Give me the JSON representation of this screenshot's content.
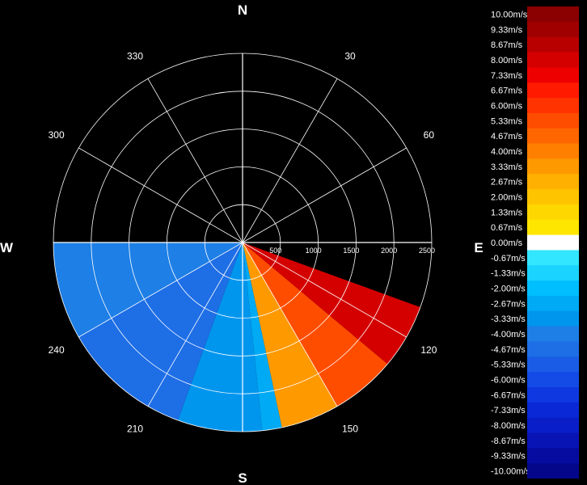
{
  "chart_data": {
    "type": "heatmap",
    "subtype": "polar radial-velocity sector scan",
    "compass": {
      "north": "N",
      "south": "S",
      "east": "E",
      "west": "W"
    },
    "azimuth_labels": [
      "30",
      "60",
      "120",
      "150",
      "210",
      "240",
      "300",
      "330"
    ],
    "range_labels": [
      "500",
      "1000",
      "1500",
      "2000",
      "2500"
    ],
    "range_max": 2500,
    "grid": true,
    "scan_sector": {
      "from_azimuth": 110,
      "to_azimuth": 270
    },
    "velocity_field": [
      {
        "azimuth_from": 110,
        "azimuth_to": 130,
        "velocity_mps": 8.0
      },
      {
        "azimuth_from": 130,
        "azimuth_to": 150,
        "velocity_mps": 5.0
      },
      {
        "azimuth_from": 150,
        "azimuth_to": 168,
        "velocity_mps": 3.33
      },
      {
        "azimuth_from": 168,
        "azimuth_to": 174,
        "velocity_mps": -2.67
      },
      {
        "azimuth_from": 174,
        "azimuth_to": 200,
        "velocity_mps": -3.33
      },
      {
        "azimuth_from": 200,
        "azimuth_to": 240,
        "velocity_mps": -4.67
      },
      {
        "azimuth_from": 240,
        "azimuth_to": 270,
        "velocity_mps": -4.0
      }
    ],
    "legend": {
      "position": "right",
      "entries": [
        {
          "label": "10.00m/s",
          "color": "#8b0000",
          "value": 10.0
        },
        {
          "label": "9.33m/s",
          "color": "#a00000",
          "value": 9.33
        },
        {
          "label": "8.67m/s",
          "color": "#b80000",
          "value": 8.67
        },
        {
          "label": "8.00m/s",
          "color": "#d40000",
          "value": 8.0
        },
        {
          "label": "7.33m/s",
          "color": "#ee0000",
          "value": 7.33
        },
        {
          "label": "6.67m/s",
          "color": "#ff1a00",
          "value": 6.67
        },
        {
          "label": "6.00m/s",
          "color": "#ff3300",
          "value": 6.0
        },
        {
          "label": "5.33m/s",
          "color": "#ff4d00",
          "value": 5.33
        },
        {
          "label": "4.67m/s",
          "color": "#ff6600",
          "value": 4.67
        },
        {
          "label": "4.00m/s",
          "color": "#ff8000",
          "value": 4.0
        },
        {
          "label": "3.33m/s",
          "color": "#ff9900",
          "value": 3.33
        },
        {
          "label": "2.67m/s",
          "color": "#ffb000",
          "value": 2.67
        },
        {
          "label": "2.00m/s",
          "color": "#ffc400",
          "value": 2.0
        },
        {
          "label": "1.33m/s",
          "color": "#ffd700",
          "value": 1.33
        },
        {
          "label": "0.67m/s",
          "color": "#ffe600",
          "value": 0.67
        },
        {
          "label": "0.00m/s",
          "color": "#ffffff",
          "value": 0.0
        },
        {
          "label": "-0.67m/s",
          "color": "#33e6ff",
          "value": -0.67
        },
        {
          "label": "-1.33m/s",
          "color": "#1ad4ff",
          "value": -1.33
        },
        {
          "label": "-2.00m/s",
          "color": "#00bfff",
          "value": -2.0
        },
        {
          "label": "-2.67m/s",
          "color": "#00aaf5",
          "value": -2.67
        },
        {
          "label": "-3.33m/s",
          "color": "#0096ee",
          "value": -3.33
        },
        {
          "label": "-4.00m/s",
          "color": "#1e7fe6",
          "value": -4.0
        },
        {
          "label": "-4.67m/s",
          "color": "#1e6ee6",
          "value": -4.67
        },
        {
          "label": "-5.33m/s",
          "color": "#1a5ce6",
          "value": -5.33
        },
        {
          "label": "-6.00m/s",
          "color": "#144ae6",
          "value": -6.0
        },
        {
          "label": "-6.67m/s",
          "color": "#0f38e0",
          "value": -6.67
        },
        {
          "label": "-7.33m/s",
          "color": "#0a28d6",
          "value": -7.33
        },
        {
          "label": "-8.00m/s",
          "color": "#0a1ec8",
          "value": -8.0
        },
        {
          "label": "-8.67m/s",
          "color": "#0814b4",
          "value": -8.67
        },
        {
          "label": "-9.33m/s",
          "color": "#060ca0",
          "value": -9.33
        },
        {
          "label": "-10.00m/s",
          "color": "#04078a",
          "value": -10.0
        }
      ]
    }
  }
}
